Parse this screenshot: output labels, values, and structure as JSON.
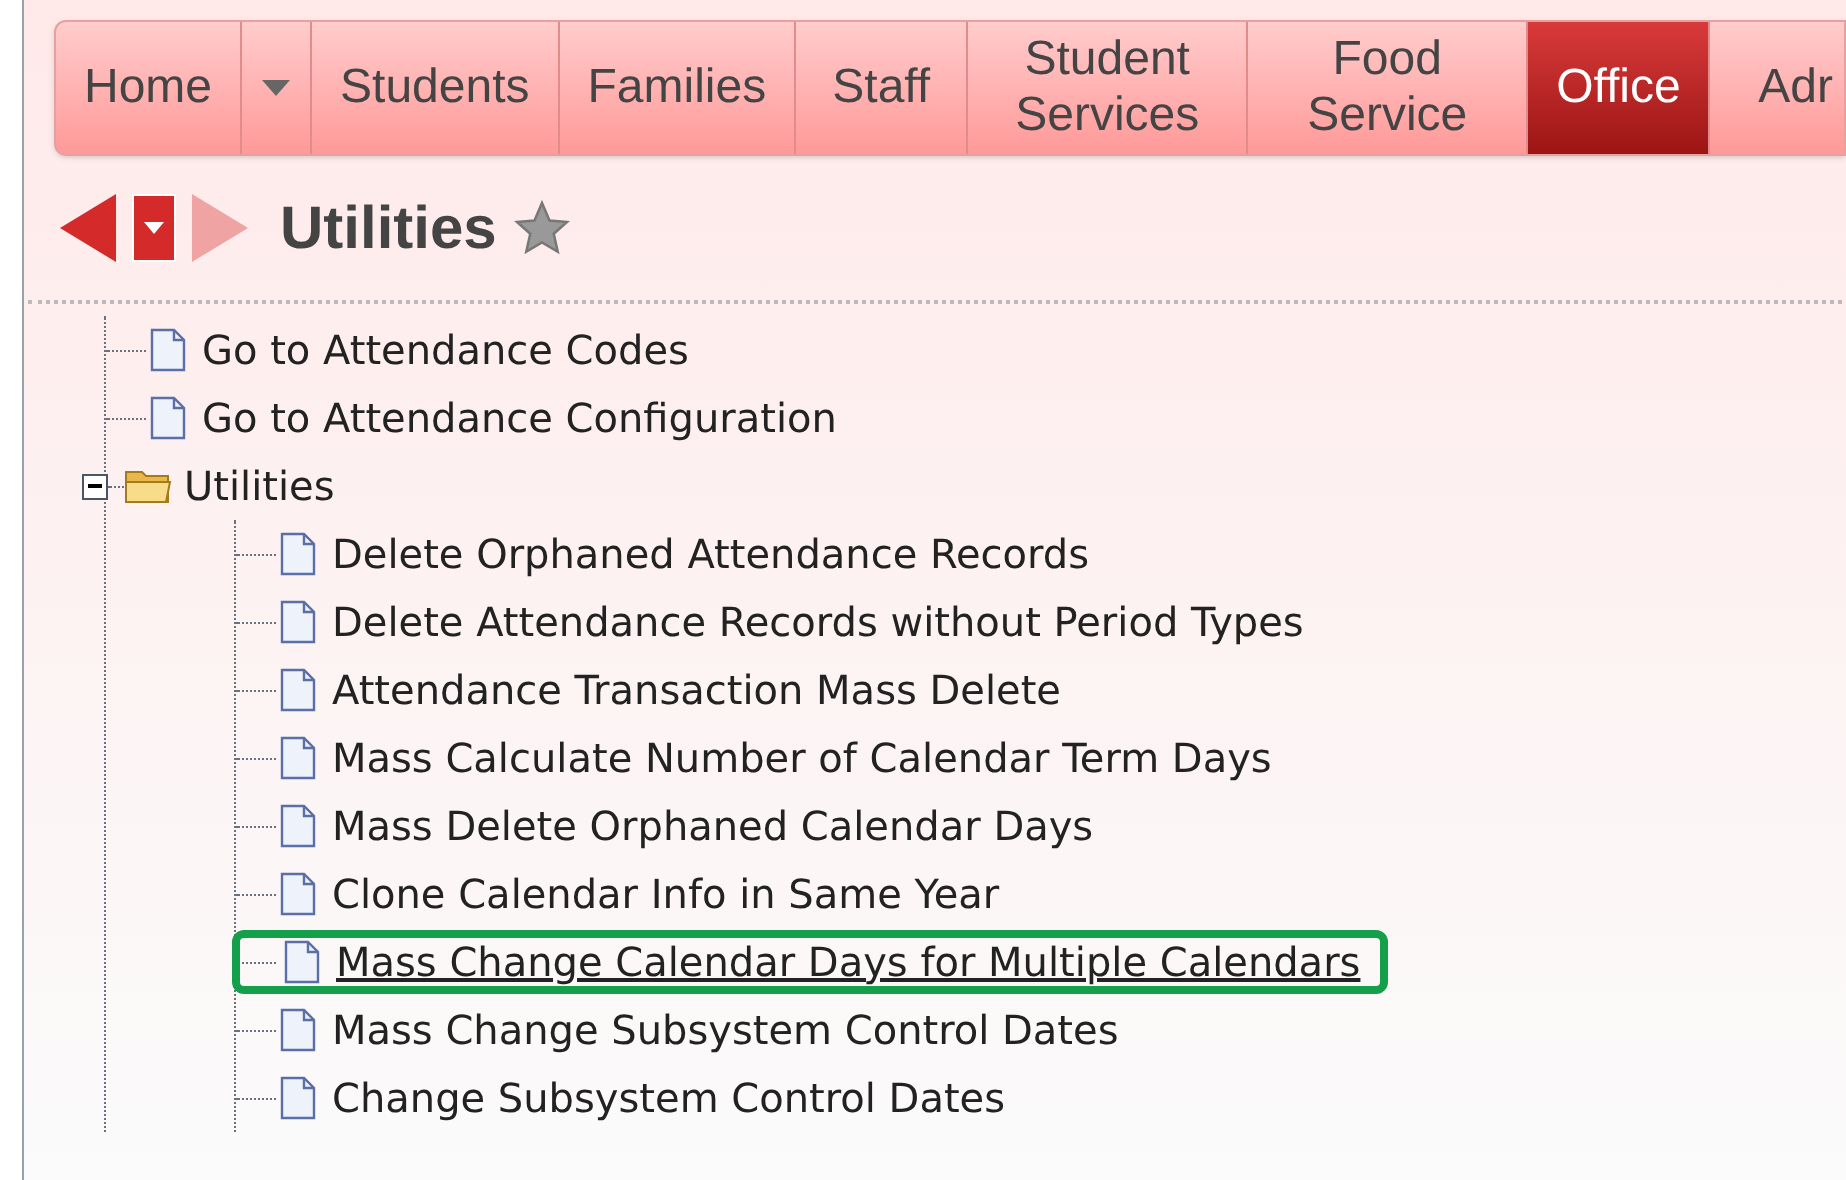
{
  "nav_tabs": [
    {
      "label": "Home",
      "selected": false,
      "kind": "tab"
    },
    {
      "selected": false,
      "kind": "dropdown"
    },
    {
      "label": "Students",
      "selected": false,
      "kind": "tab"
    },
    {
      "label": "Families",
      "selected": false,
      "kind": "tab"
    },
    {
      "label": "Staff",
      "selected": false,
      "kind": "tab"
    },
    {
      "label": "Student Services",
      "selected": false,
      "kind": "tab"
    },
    {
      "label": "Food Service",
      "selected": false,
      "kind": "tab"
    },
    {
      "label": "Office",
      "selected": true,
      "kind": "tab"
    },
    {
      "label": "Adr",
      "selected": false,
      "kind": "tab"
    }
  ],
  "page_title": "Utilities",
  "tree": [
    {
      "kind": "page",
      "label": "Go to Attendance Codes",
      "highlighted": false
    },
    {
      "kind": "page",
      "label": "Go to Attendance Configuration",
      "highlighted": false
    },
    {
      "kind": "folder",
      "label": "Utilities",
      "expanded": true,
      "children": [
        {
          "kind": "page",
          "label": "Delete Orphaned Attendance Records",
          "highlighted": false
        },
        {
          "kind": "page",
          "label": "Delete Attendance Records without Period Types",
          "highlighted": false
        },
        {
          "kind": "page",
          "label": "Attendance Transaction Mass Delete",
          "highlighted": false
        },
        {
          "kind": "page",
          "label": "Mass Calculate Number of Calendar Term Days",
          "highlighted": false
        },
        {
          "kind": "page",
          "label": "Mass Delete Orphaned Calendar Days",
          "highlighted": false
        },
        {
          "kind": "page",
          "label": "Clone Calendar Info in Same Year",
          "highlighted": false
        },
        {
          "kind": "page",
          "label": "Mass Change Calendar Days for Multiple Calendars",
          "highlighted": true
        },
        {
          "kind": "page",
          "label": "Mass Change Subsystem Control Dates",
          "highlighted": false
        },
        {
          "kind": "page",
          "label": "Change Subsystem Control Dates",
          "highlighted": false
        }
      ]
    }
  ]
}
